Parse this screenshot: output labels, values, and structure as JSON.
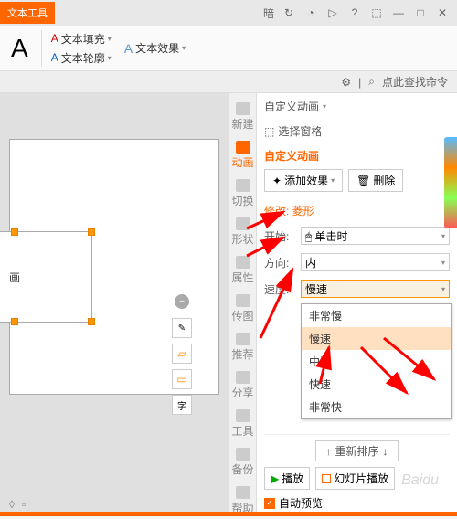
{
  "topbar": {
    "tool_tab": "文本工具",
    "theme_label": "暗"
  },
  "ribbon": {
    "text_fill": "文本填充",
    "text_outline": "文本轮廓",
    "text_effects": "文本效果"
  },
  "search": {
    "placeholder": "点此查找命令"
  },
  "sidebar_nav": {
    "items": [
      {
        "label": "新建"
      },
      {
        "label": "动画"
      },
      {
        "label": "切换"
      },
      {
        "label": "形状"
      },
      {
        "label": "属性"
      },
      {
        "label": "传图"
      },
      {
        "label": "推荐"
      },
      {
        "label": "分享"
      },
      {
        "label": "工具"
      },
      {
        "label": "备份"
      },
      {
        "label": "帮助"
      }
    ]
  },
  "panel": {
    "title": "自定义动画",
    "select_pane": "选择窗格",
    "section_title": "自定义动画",
    "add_effect": "添加效果",
    "delete": "删除",
    "modify_label": "修改: 菱形",
    "start_label": "开始:",
    "start_value": "单击时",
    "direction_label": "方向:",
    "direction_value": "内",
    "speed_label": "速度:",
    "speed_value": "慢速",
    "speed_options": [
      "非常慢",
      "慢速",
      "中速",
      "快速",
      "非常快"
    ],
    "reorder": "重新排序",
    "play": "播放",
    "slideshow": "幻灯片播放",
    "auto_preview": "自动预览"
  },
  "canvas": {
    "shape_text": "画"
  }
}
